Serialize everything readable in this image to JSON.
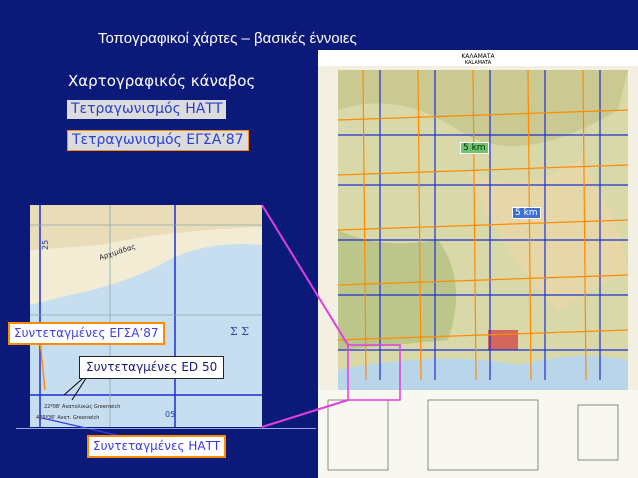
{
  "slide": {
    "title": "Τοπογραφικοί χάρτες – βασικές έννοιες",
    "subtitle": "Χαρτογραφικός κάναβος",
    "grid_hatt_label": "Τετραγωνισμός ΗΑΤΤ",
    "grid_egsa_label": "Τετραγωνισμός ΕΓΣΑ’87",
    "coord_egsa_label": "Συντεταγμένες ΕΓΣΑ’87",
    "coord_ed50_label": "Συντεταγμένες ED 50",
    "coord_hatt_label": "Συντεταγμένες ΗΑΤΤ",
    "km_label_1": "5 km",
    "km_label_2": "5 km"
  },
  "map": {
    "sheet_name": "ΚΑΛΑΜΑΤΑ",
    "sheet_name_2": "KALAMATA",
    "grid_colors": {
      "hatt": "#1f2fd6",
      "egsa": "#ff8c00"
    }
  },
  "inset": {
    "place_label": "Αρχιμάδας",
    "sea_label": "Σ Σ",
    "coord_bottom": "05",
    "coord_left": "25",
    "greenwich_1": "22º08' Ανατολικώς Greenwich",
    "greenwich_2": "435º36' Ανατ. Greenwich"
  },
  "colors": {
    "background": "#0b1a78",
    "highlight_box": "#e03fe0",
    "accent_orange": "#ff8c00"
  }
}
